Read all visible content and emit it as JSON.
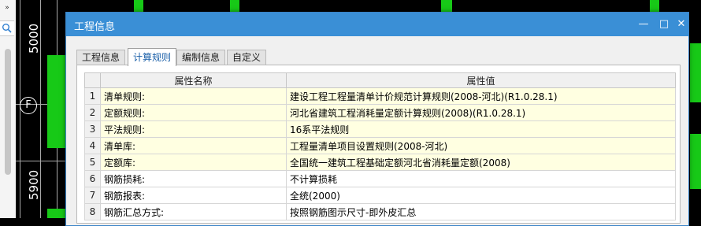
{
  "side_panel": {
    "expand_glyph": "»",
    "search_icon": "search-icon"
  },
  "cad": {
    "dim_labels": [
      "5000",
      "5900"
    ],
    "axis_label": "F",
    "colors": {
      "background": "#000000",
      "member": "#17c917",
      "grid_line": "#a8a8a8"
    }
  },
  "dialog": {
    "title": "工程信息",
    "buttons": {
      "minimize": "—",
      "maximize": "□",
      "close": "✕"
    },
    "tabs": [
      {
        "label": "工程信息",
        "active": false
      },
      {
        "label": "计算规则",
        "active": true
      },
      {
        "label": "编制信息",
        "active": false
      },
      {
        "label": "自定义",
        "active": false
      }
    ],
    "grid": {
      "headers": {
        "name": "属性名称",
        "value": "属性值"
      },
      "rows": [
        {
          "num": "1",
          "name": "清单规则:",
          "value": "建设工程工程量清单计价规范计算规则(2008-河北)(R1.0.28.1)",
          "style": "yellow"
        },
        {
          "num": "2",
          "name": "定额规则:",
          "value": "河北省建筑工程消耗量定额计算规则(2008)(R1.0.28.1)",
          "style": "yellow"
        },
        {
          "num": "3",
          "name": "平法规则:",
          "value": "16系平法规则",
          "style": "yellow"
        },
        {
          "num": "4",
          "name": "清单库:",
          "value": "工程量清单项目设置规则(2008-河北)",
          "style": "yellow"
        },
        {
          "num": "5",
          "name": "定额库:",
          "value": "全国统一建筑工程基础定额河北省消耗量定额(2008)",
          "style": "yellow"
        },
        {
          "num": "6",
          "name": "钢筋损耗:",
          "value": "不计算损耗",
          "style": "white"
        },
        {
          "num": "7",
          "name": "钢筋报表:",
          "value": "全统(2000)",
          "style": "white"
        },
        {
          "num": "8",
          "name": "钢筋汇总方式:",
          "value": "按照钢筋图示尺寸-即外皮汇总",
          "style": "white"
        }
      ]
    },
    "colors": {
      "titlebar": "#3a8fd6",
      "row_highlight": "#ffffe1"
    }
  }
}
